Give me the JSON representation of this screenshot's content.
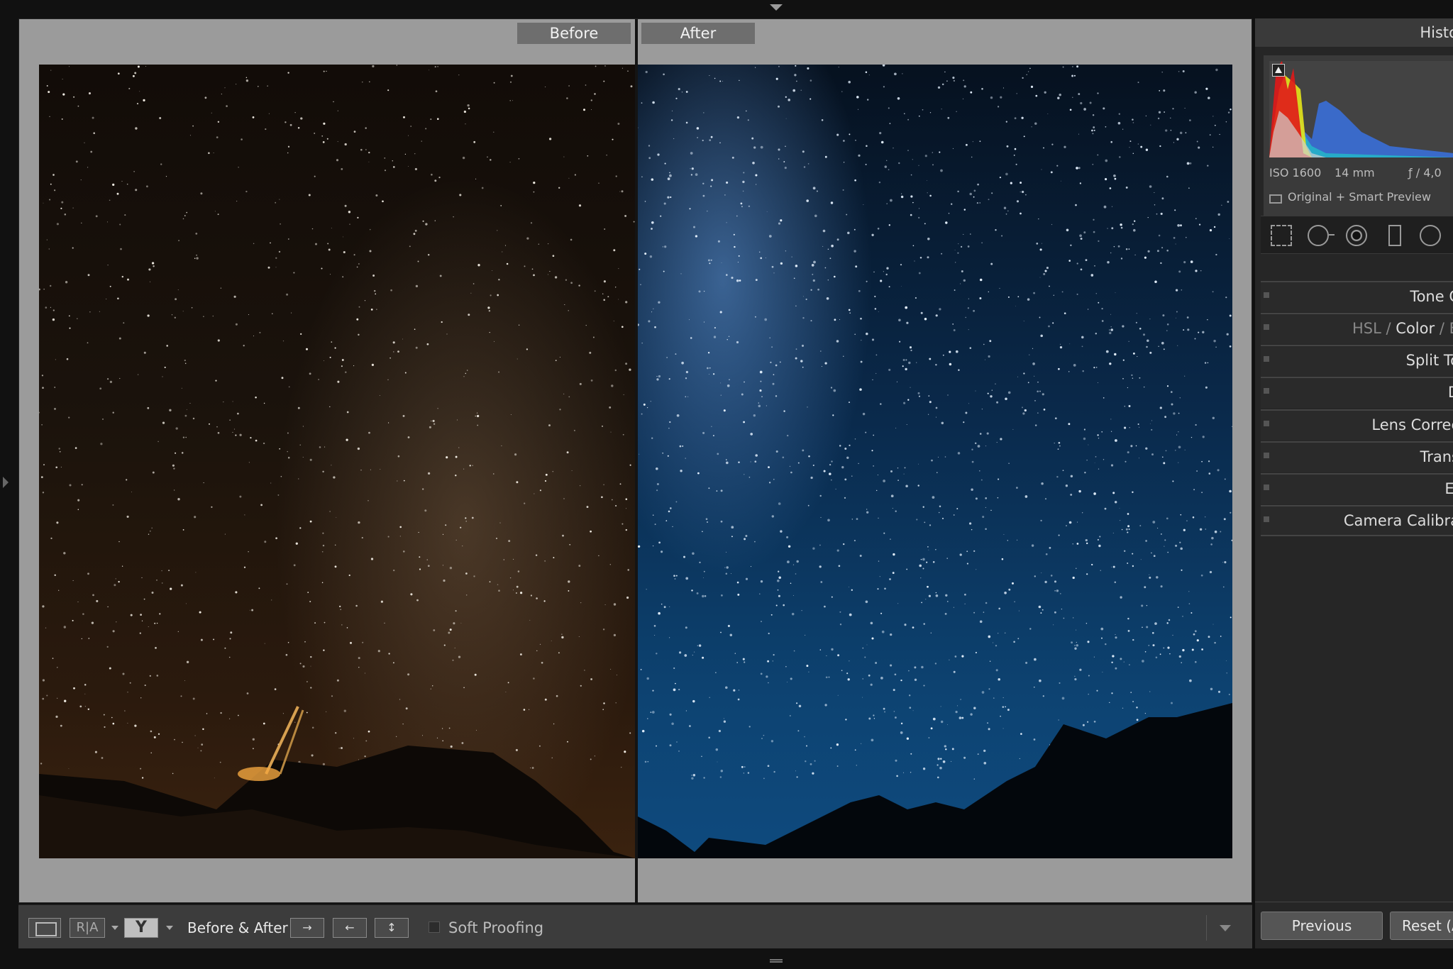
{
  "view": {
    "before_label": "Before",
    "after_label": "After"
  },
  "toolbar": {
    "ra_label": "R|A",
    "yy_label": "Y",
    "before_after_label": "Before & After :",
    "swap_left_right": "→",
    "swap_right_left": "←",
    "swap_vertical": "↕",
    "soft_proofing_label": "Soft Proofing"
  },
  "panel": {
    "histogram_title": "Histo",
    "exif": {
      "iso": "ISO 1600",
      "focal": "14 mm",
      "aperture": "ƒ / 4,0"
    },
    "preview_status": "Original + Smart Preview",
    "sections": [
      {
        "label": "Tone C"
      },
      {
        "hsl": "HSL",
        "sep": "/",
        "color": "Color",
        "bw": "B"
      },
      {
        "label": "Split To"
      },
      {
        "label": "D"
      },
      {
        "label": "Lens Correc"
      },
      {
        "label": "Trans"
      },
      {
        "label": "Ef"
      },
      {
        "label": "Camera Calibra"
      }
    ],
    "previous_label": "Previous",
    "reset_label": "Reset (A"
  },
  "colors": {
    "accent_before": "#2b1a0d",
    "accent_after": "#0e4a7e"
  }
}
